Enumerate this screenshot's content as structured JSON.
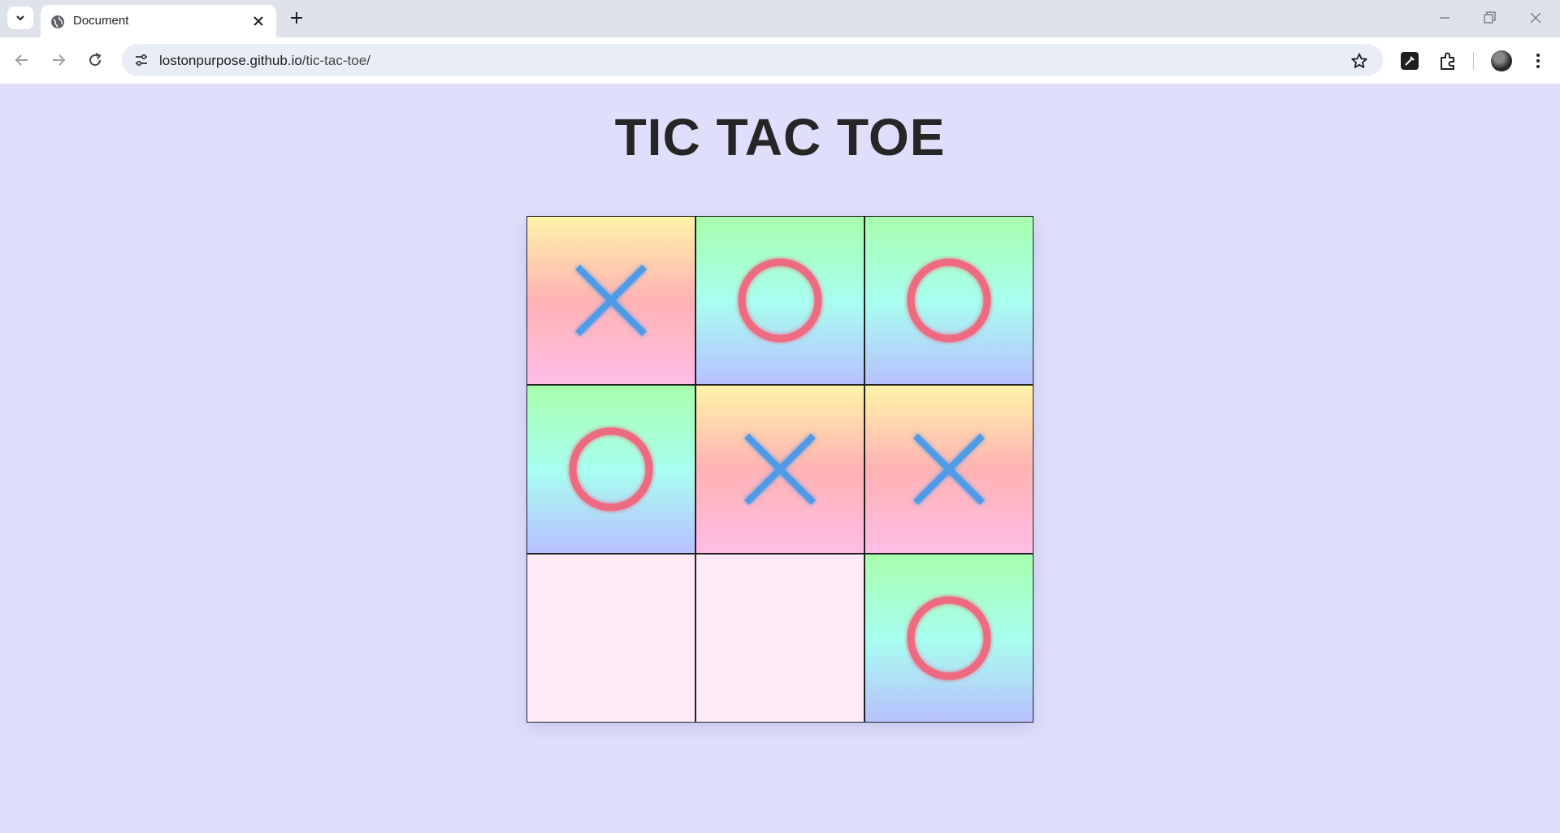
{
  "browser": {
    "tab_title": "Document",
    "url_host": "lostonpurpose.github.io",
    "url_path": "/tic-tac-toe/",
    "icons": [
      "tab-search-icon",
      "globe-icon",
      "close-icon",
      "plus-icon",
      "minimize-icon",
      "restore-icon",
      "close-window-icon",
      "back-icon",
      "forward-icon",
      "reload-icon",
      "site-info-icon",
      "star-icon",
      "pen-icon",
      "extensions-icon",
      "profile-avatar",
      "menu-icon"
    ]
  },
  "page": {
    "title": "TIC TAC TOE"
  },
  "board": {
    "cells": [
      "X",
      "O",
      "O",
      "O",
      "X",
      "X",
      "",
      "",
      "O"
    ]
  },
  "colors": {
    "page_bg": "#dfdffb",
    "x_mark": "#4f9be8",
    "o_mark": "#ee6b80",
    "empty_cell": "#feeaf4"
  }
}
